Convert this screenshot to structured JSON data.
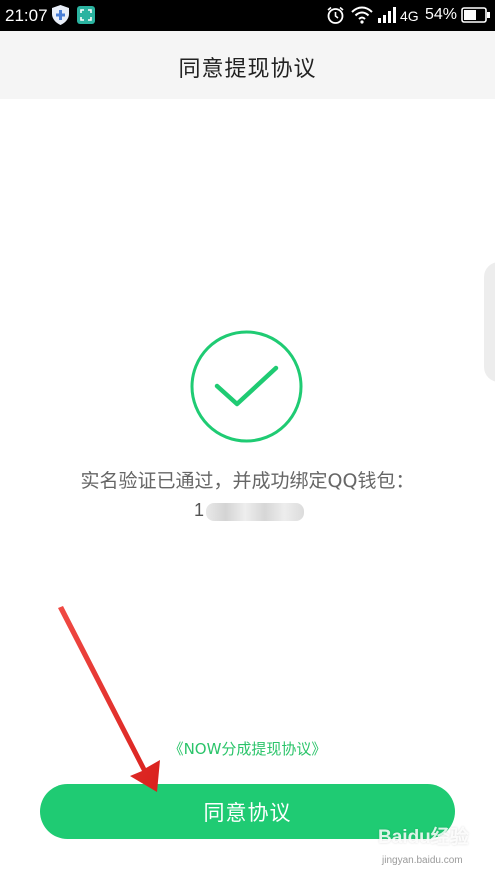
{
  "status_bar": {
    "time": "21:07",
    "network_type": "4G",
    "battery": "54%",
    "icons": [
      "shield-icon",
      "scan-icon",
      "alarm-icon",
      "wifi-icon",
      "signal-icon",
      "battery-icon"
    ]
  },
  "header": {
    "title": "同意提现协议"
  },
  "result": {
    "icon": "check-circle-icon",
    "message": "实名验证已通过，并成功绑定QQ钱包：",
    "account_prefix": "1"
  },
  "agreement": {
    "link_text": "《NOW分成提现协议》"
  },
  "actions": {
    "agree_label": "同意协议"
  },
  "watermark": {
    "text": "Baidu经验",
    "sub": "jingyan.baidu.com"
  },
  "colors": {
    "accent": "#1fcb73",
    "link": "#2bc46a",
    "annotation_arrow": "#e8312f"
  }
}
